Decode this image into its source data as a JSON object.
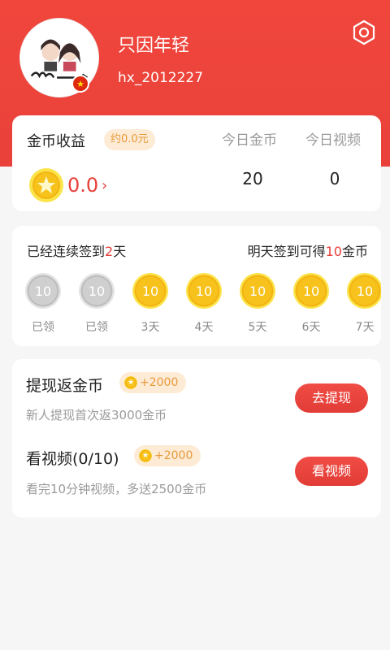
{
  "profile": {
    "nickname": "只因年轻",
    "username": "hx_2012227"
  },
  "earnings": {
    "title": "金币收益",
    "approx_badge": "约0.0元",
    "amount": "0.0",
    "chevron": "›",
    "today_coin_label": "今日金币",
    "today_coin_value": "20",
    "today_video_label": "今日视频",
    "today_video_value": "0"
  },
  "signin": {
    "streak_prefix": "已经连续签到",
    "streak_days": "2",
    "streak_suffix": "天",
    "tomorrow_prefix": "明天签到可得",
    "tomorrow_coins": "10",
    "tomorrow_suffix": "金币",
    "days": [
      {
        "value": "10",
        "label": "已领",
        "state": "used"
      },
      {
        "value": "10",
        "label": "已领",
        "state": "used"
      },
      {
        "value": "10",
        "label": "3天",
        "state": "gold"
      },
      {
        "value": "10",
        "label": "4天",
        "state": "gold"
      },
      {
        "value": "10",
        "label": "5天",
        "state": "gold"
      },
      {
        "value": "10",
        "label": "6天",
        "state": "gold"
      },
      {
        "value": "10",
        "label": "7天",
        "state": "gold"
      }
    ]
  },
  "tasks": [
    {
      "title": "提现返金币",
      "reward": "+2000",
      "desc": "新人提现首次返3000金币",
      "button": "去提现"
    },
    {
      "title": "看视频(0/10)",
      "reward": "+2000",
      "desc": "看完10分钟视频，多送2500金币",
      "button": "看视频"
    }
  ],
  "colors": {
    "header_red": "#ee453c",
    "accent_red": "#e8403a",
    "coin_gold": "#f7c21b",
    "badge_bg": "#fdebd5",
    "badge_text": "#e89a3c"
  },
  "icons": {
    "settings": "settings-icon",
    "avatar": "avatar-image",
    "flag": "china-flag-badge"
  }
}
